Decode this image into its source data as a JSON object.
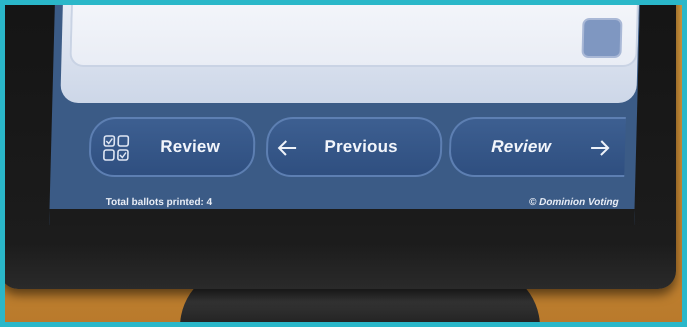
{
  "nav": {
    "review_left_label": "Review",
    "previous_label": "Previous",
    "review_right_label": "Review"
  },
  "status": {
    "ballots_printed": "Total ballots printed: 4",
    "vendor": "© Dominion Voting"
  },
  "colors": {
    "screen_bg": "#3b5b86",
    "button_bg": "#3d5f91",
    "panel_bg": "#e6ebf4",
    "checkbox": "#7f97c1"
  },
  "icons": {
    "review_left": "checklist-grid-icon",
    "previous": "arrow-left-icon",
    "review_right": "arrow-right-icon"
  }
}
